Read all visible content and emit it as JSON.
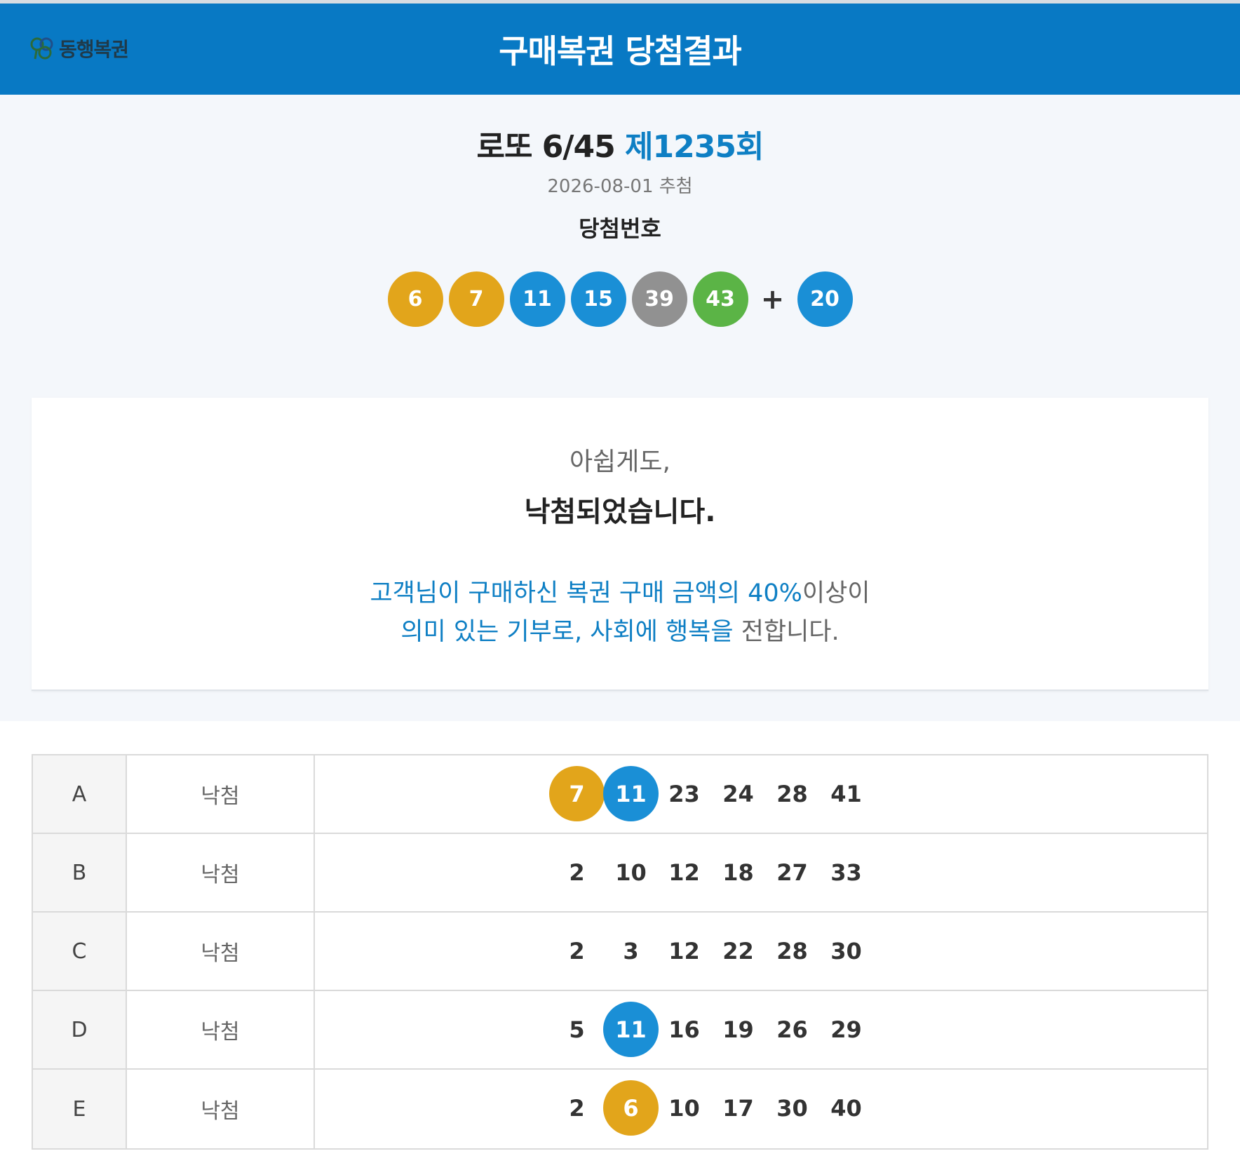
{
  "header": {
    "logo_text": "동행복권",
    "title": "구매복권 당첨결과"
  },
  "draw": {
    "game": "로또 6/45",
    "round": "제1235회",
    "date": "2026-08-01 추첨",
    "label": "당첨번호",
    "numbers": [
      6,
      7,
      11,
      15,
      39,
      43
    ],
    "plus": "+",
    "bonus": 20
  },
  "ball_colors": {
    "1-10": "#e2a51b",
    "11-20": "#1a8fd6",
    "31-40": "#919191",
    "41-45": "#5bb446"
  },
  "result": {
    "sub": "아쉽게도,",
    "main": "낙첨되었습니다.",
    "line1_blue": "고객님이 구매하신 복권 구매 금액의 40%",
    "line1_gray": "이상이",
    "line2_blue": "의미 있는 기부로, 사회에 행복을",
    "line2_gray": " 전합니다."
  },
  "tickets": [
    {
      "id": "A",
      "status": "낙첨",
      "numbers": [
        7,
        11,
        23,
        24,
        28,
        41
      ],
      "hits": [
        7,
        11
      ]
    },
    {
      "id": "B",
      "status": "낙첨",
      "numbers": [
        2,
        10,
        12,
        18,
        27,
        33
      ],
      "hits": []
    },
    {
      "id": "C",
      "status": "낙첨",
      "numbers": [
        2,
        3,
        12,
        22,
        28,
        30
      ],
      "hits": []
    },
    {
      "id": "D",
      "status": "낙첨",
      "numbers": [
        5,
        11,
        16,
        19,
        26,
        29
      ],
      "hits": [
        11
      ]
    },
    {
      "id": "E",
      "status": "낙첨",
      "numbers": [
        2,
        6,
        10,
        17,
        30,
        40
      ],
      "hits": [
        6
      ]
    }
  ]
}
